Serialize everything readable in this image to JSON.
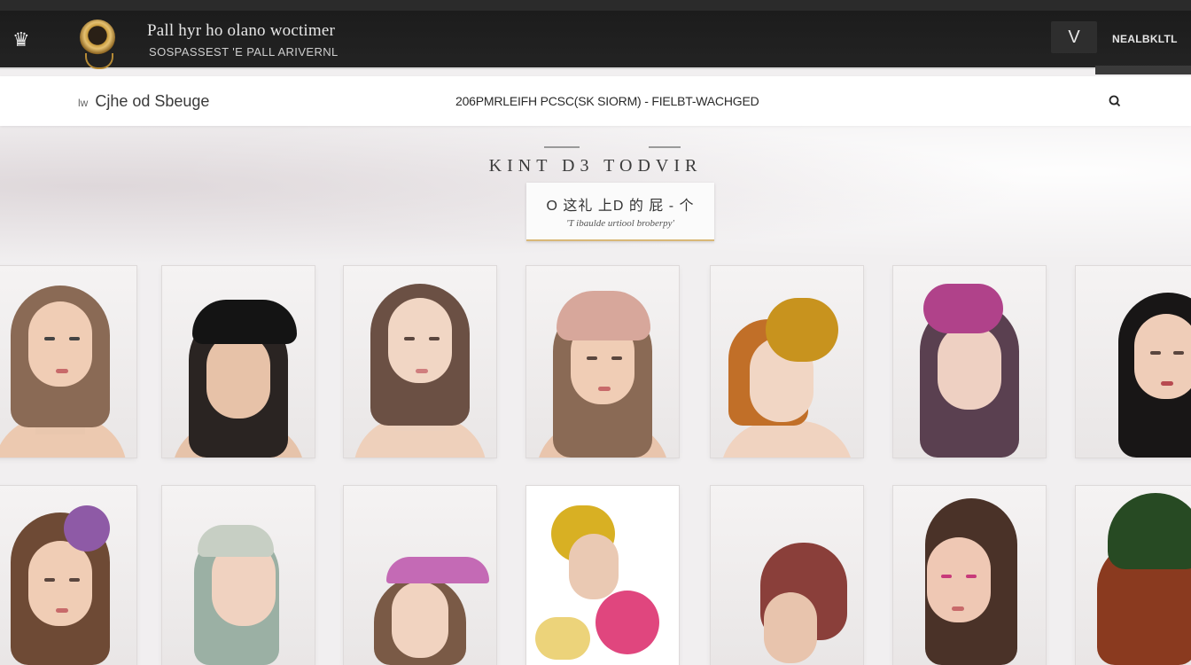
{
  "header": {
    "brand_title": "Pall hyr ho olano woctimer",
    "brand_sub": "SOSPASSEST 'E  PALL ARIVERNL",
    "v_button": "V",
    "account_label": "NEALBKLTL"
  },
  "nav": {
    "left_prefix": "lw",
    "left_label": "Cjhe od Sbeuge",
    "center_text": "206PMRLEIFH PCSC(SK SIORM) - FIELBT-WACHGED"
  },
  "hero": {
    "title": "KINT D3  TODVIR",
    "box_line1": "O   这礼 上D 的 屁 - 个",
    "box_line2": "'T ibaulde urtiool broberpy'"
  },
  "icons": {
    "crown": "crown-icon",
    "logo": "medallion-logo",
    "search": "search-icon"
  },
  "colors": {
    "header_bg": "#1f1f1f",
    "accent_gold": "#d9b878",
    "page_bg": "#f1eff0"
  }
}
